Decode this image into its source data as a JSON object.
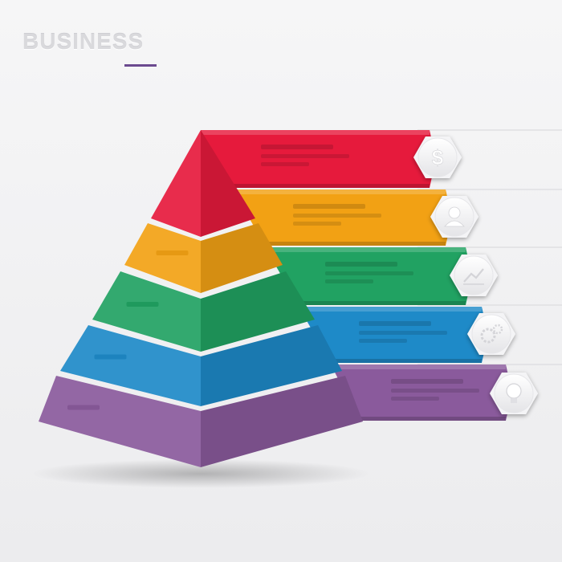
{
  "header": {
    "title": "BUSINESS"
  },
  "levels": [
    {
      "id": "level-1",
      "color": "#e61a3c",
      "icon": "dollar-icon"
    },
    {
      "id": "level-2",
      "color": "#f2a114",
      "icon": "user-icon"
    },
    {
      "id": "level-3",
      "color": "#21a262",
      "icon": "chart-icon"
    },
    {
      "id": "level-4",
      "color": "#1e8ac8",
      "icon": "gear-icon"
    },
    {
      "id": "level-5",
      "color": "#8a5a9c",
      "icon": "lightbulb-icon"
    }
  ]
}
